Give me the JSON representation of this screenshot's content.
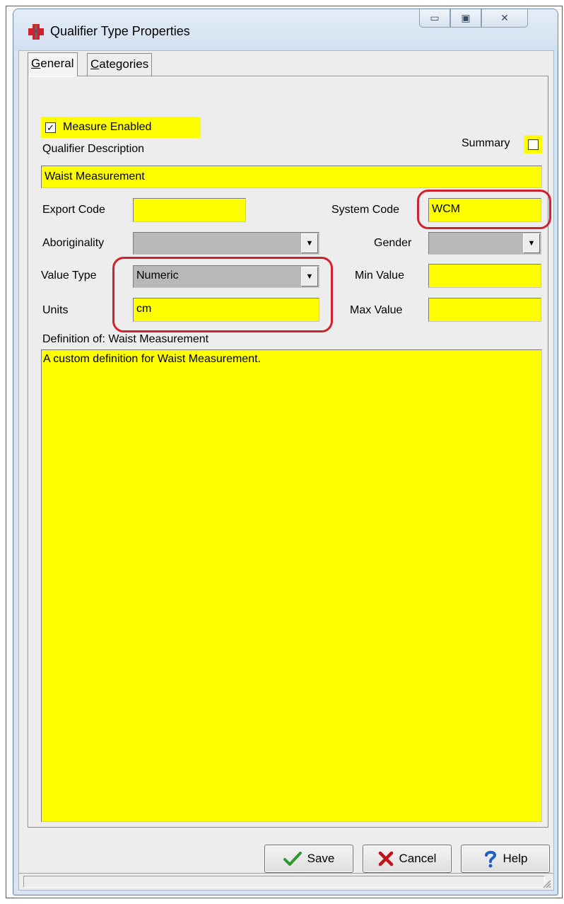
{
  "window": {
    "title": "Qualifier Type Properties",
    "icon": "caduceus-icon",
    "caption_buttons": [
      "minimize",
      "maximize",
      "close"
    ],
    "caption_glyphs": {
      "minimize": "▭",
      "maximize": "▣",
      "close": "✕"
    }
  },
  "tabs": [
    {
      "label": "General",
      "selected": true
    },
    {
      "label": "Categories",
      "selected": false
    }
  ],
  "general": {
    "measure_enabled": {
      "label": "Measure Enabled",
      "checked": true,
      "check_glyph": "✓"
    },
    "qualifier_description": {
      "label": "Qualifier Description",
      "value": "Waist Measurement"
    },
    "summary": {
      "label": "Summary",
      "checked": false
    },
    "export_code": {
      "label": "Export Code",
      "value": ""
    },
    "system_code": {
      "label": "System Code",
      "value": "WCM"
    },
    "aboriginality": {
      "label": "Aboriginality",
      "value": ""
    },
    "gender": {
      "label": "Gender",
      "value": ""
    },
    "value_type": {
      "label": "Value Type",
      "value": "Numeric"
    },
    "min_value": {
      "label": "Min Value",
      "value": ""
    },
    "units": {
      "label": "Units",
      "value": "cm"
    },
    "max_value": {
      "label": "Max Value",
      "value": ""
    },
    "definition": {
      "label": "Definition of: Waist Measurement",
      "value": "A custom definition for Waist Measurement."
    },
    "dropdown_glyph": "▼"
  },
  "buttons": {
    "save": "Save",
    "cancel": "Cancel",
    "help": "Help"
  },
  "colors": {
    "field_highlight": "#ffff00",
    "annotation_ring": "#d1202e",
    "save_check": "#2e9a2e",
    "cancel_x": "#c0121a",
    "help_question": "#1f5fbf"
  }
}
